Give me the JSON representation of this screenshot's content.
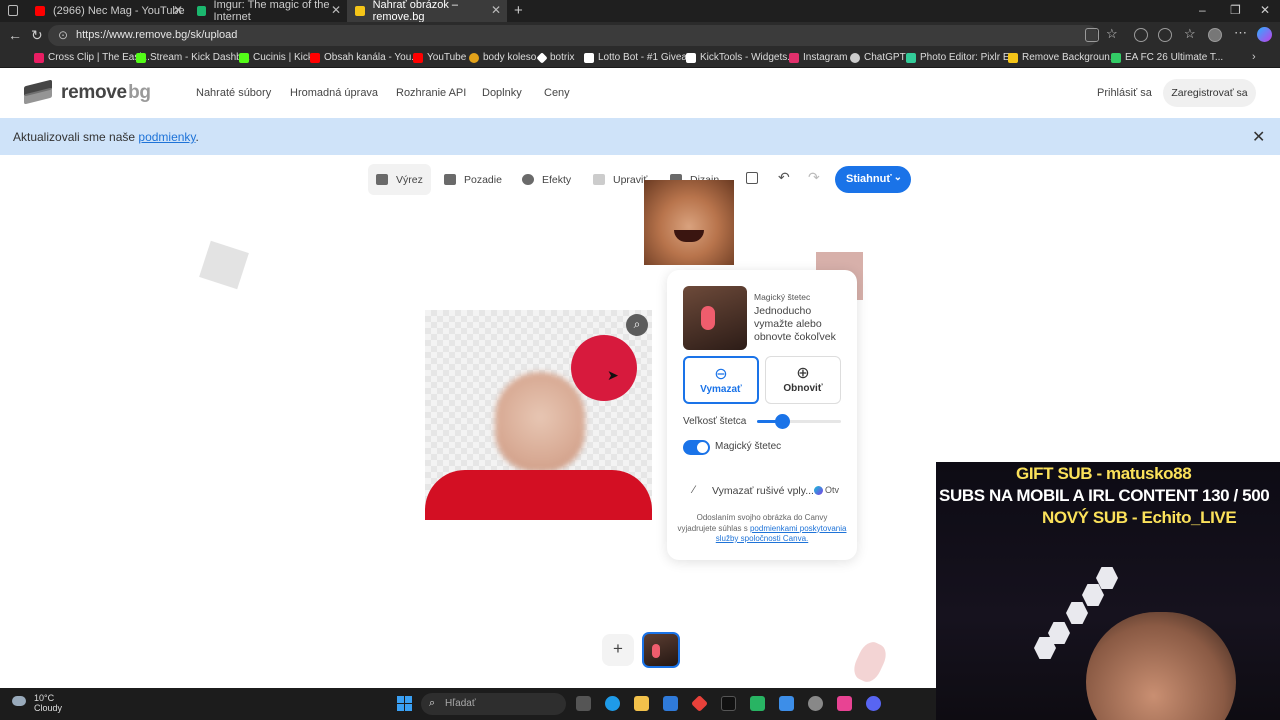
{
  "browser": {
    "tabs": [
      {
        "title": "(2966) Nec Mag - YouTube",
        "color": "#ff0000"
      },
      {
        "title": "Imgur: The magic of the Internet",
        "color": "#1bb76e"
      },
      {
        "title": "Nahrať obrázok – remove.bg",
        "color": "#f5c518"
      }
    ],
    "new_tab_label": "+",
    "url": "https://www.remove.bg/sk/upload",
    "bookmarks": [
      {
        "label": "Cross Clip | The Easi...",
        "color": "#e91e63"
      },
      {
        "label": "Stream - Kick Dashb...",
        "color": "#53fc18"
      },
      {
        "label": "Cucinis | Kick",
        "color": "#53fc18"
      },
      {
        "label": "Obsah kanála - You...",
        "color": "#ff0000"
      },
      {
        "label": "YouTube",
        "color": "#ff0000"
      },
      {
        "label": "body koleso",
        "color": "#e3a21a"
      },
      {
        "label": "botrix",
        "color": "#ffffff"
      },
      {
        "label": "Lotto Bot - #1 Givea...",
        "color": "#ffffff"
      },
      {
        "label": "KickTools - Widgets...",
        "color": "#ffffff"
      },
      {
        "label": "Instagram",
        "color": "#e1306c"
      },
      {
        "label": "ChatGPT",
        "color": "#cccccc"
      },
      {
        "label": "Photo Editor: Pixlr E...",
        "color": "#33cc99"
      },
      {
        "label": "Remove Backgroun...",
        "color": "#f5c518"
      },
      {
        "label": "EA FC 26 Ultimate T...",
        "color": "#33cc66"
      }
    ]
  },
  "site": {
    "logo": {
      "part1": "remove",
      "part2": "bg"
    },
    "nav": [
      "Nahraté súbory",
      "Hromadná úprava",
      "Rozhranie API",
      "Doplnky",
      "Ceny"
    ],
    "login": "Prihlásiť sa",
    "register": "Zaregistrovať sa",
    "banner": {
      "text": "Aktualizovali sme naše ",
      "link": "podmienky",
      "suffix": ".",
      "close": "✕"
    },
    "toolbar": {
      "tools": [
        "Výrez",
        "Pozadie",
        "Efekty",
        "Upraviť",
        "Dizajn"
      ],
      "selected": "Výrez",
      "download": "Stiahnuť"
    },
    "editor_panel": {
      "title": "Magický štetec",
      "description": "Jednoducho vymažte alebo obnovte čokoľvek",
      "erase": "Vymazať",
      "restore": "Obnoviť",
      "brush_size_label": "Veľkosť štetca",
      "brush_size": 0.3,
      "magic_brush_label": "Magický štetec",
      "magic_brush_on": true,
      "remove_noise": "Vymazať rušivé vply...",
      "canva_badge": "Otv",
      "terms_prefix": "Odoslaním svojho obrázka do Canvy vyjadrujete súhlas s ",
      "terms_link": "podmienkami poskytovania služby spoločnosti Canva."
    },
    "add_image": "+",
    "accent_color": "#1a73e8"
  },
  "stream_overlay": {
    "line1": "GIFT SUB - matusko88",
    "line2": "SUBS NA MOBIL A IRL CONTENT  130 / 500",
    "line3": "NOVÝ SUB - Echito_LIVE"
  },
  "taskbar": {
    "temperature": "10°C",
    "condition": "Cloudy",
    "search_placeholder": "Hľadať"
  }
}
